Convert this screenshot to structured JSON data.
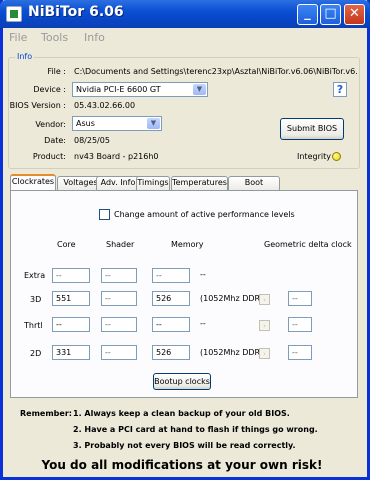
{
  "window": {
    "title": "NiBiTor 6.06"
  },
  "menu": [
    "File",
    "Tools",
    "Info"
  ],
  "info": {
    "group_label": "Info",
    "file_label": "File :",
    "file_value": "C:\\Documents and Settings\\terenc23xp\\Asztal\\NiBiTor.v6.06\\NiBiTor.v6.06\\vga",
    "device_label": "Device :",
    "device_value": "Nvidia PCI-E 6600 GT",
    "bios_version_label": "BIOS Version :",
    "bios_version_value": "05.43.02.66.00",
    "vendor_label": "Vendor:",
    "vendor_value": "Asus",
    "date_label": "Date:",
    "date_value": "08/25/05",
    "product_label": "Product:",
    "product_value": "nv43 Board - p216h0",
    "integrity_label": "Integrity :",
    "submit_label": "Submit BIOS",
    "help_label": "?"
  },
  "tabs": [
    "Clockrates",
    "Voltages",
    "Adv. Info",
    "Timings",
    "Temperatures",
    "Boot Settings"
  ],
  "clockrates": {
    "checkbox_label": "Change amount of active performance levels",
    "headers": {
      "core": "Core",
      "shader": "Shader",
      "memory": "Memory",
      "delta": "Geometric delta clock"
    },
    "rows": [
      {
        "label": "Extra",
        "core": "--",
        "shader": "--",
        "memory": "--",
        "ddr": "--",
        "delta": ""
      },
      {
        "label": "3D",
        "core": "551",
        "shader": "--",
        "memory": "526",
        "ddr": "(1052Mhz DDR)",
        "delta": "--"
      },
      {
        "label": "Thrtl",
        "core": "--",
        "shader": "--",
        "memory": "--",
        "ddr": "--",
        "delta": "--"
      },
      {
        "label": "2D",
        "core": "331",
        "shader": "--",
        "memory": "526",
        "ddr": "(1052Mhz DDR)",
        "delta": "--"
      }
    ],
    "bootup_button": "Bootup clocks"
  },
  "remember": {
    "label": "Remember:",
    "items": [
      "1. Always keep a clean backup of your old BIOS.",
      "2. Have a PCI card at hand to flash if things go wrong.",
      "3. Probably not every BIOS will be read correctly."
    ],
    "warning": "You do all modifications at your own risk!"
  },
  "colors": {
    "title_bar": "#0a4fd4",
    "group_label": "#0046d5",
    "integrity": "#e8d300"
  }
}
